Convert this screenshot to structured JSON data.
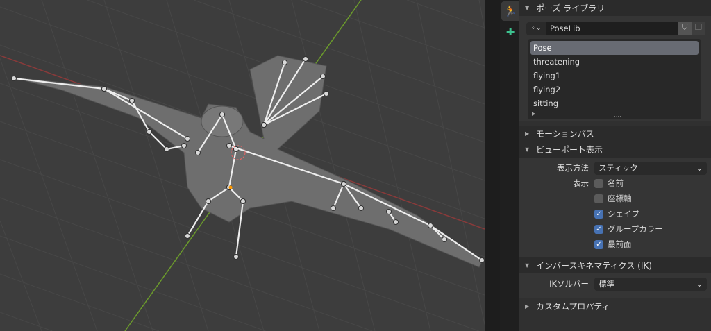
{
  "tabs": [
    {
      "icon": "pose-icon",
      "active": true
    },
    {
      "icon": "bone-icon",
      "active": false
    }
  ],
  "pose_library": {
    "title": "ポーズ ライブラリ",
    "datablock": "PoseLib",
    "poses": [
      "Pose",
      "threatening",
      "flying1",
      "flying2",
      "sitting"
    ],
    "selected": "Pose"
  },
  "motion_paths": {
    "title": "モーションパス"
  },
  "viewport_display": {
    "title": "ビューポート表示",
    "display_as_label": "表示方法",
    "display_as_value": "スティック",
    "show_label": "表示",
    "options": [
      {
        "label": "名前",
        "checked": false
      },
      {
        "label": "座標軸",
        "checked": false
      },
      {
        "label": "シェイプ",
        "checked": true
      },
      {
        "label": "グループカラー",
        "checked": true
      },
      {
        "label": "最前面",
        "checked": true
      }
    ]
  },
  "ik": {
    "title": "インバースキネマティクス (IK)",
    "solver_label": "IKソルバー",
    "solver_value": "標準"
  },
  "custom_props": {
    "title": "カスタムプロパティ"
  },
  "colors": {
    "x_axis": "#9a3c3c",
    "y_axis": "#6b9a2c",
    "accent": "#4772b3",
    "tab_icon": "#3dc28f"
  }
}
